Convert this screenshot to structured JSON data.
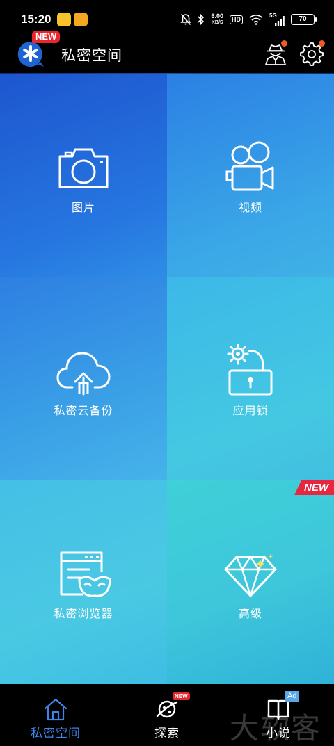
{
  "status_bar": {
    "time": "15:20",
    "net_speed_value": "6.00",
    "net_speed_unit": "KB/S",
    "hd": "HD",
    "signal_tag": "5G",
    "battery": "70"
  },
  "header": {
    "new_badge": "NEW",
    "title": "私密空间"
  },
  "tiles": [
    {
      "label": "图片",
      "icon": "camera-icon"
    },
    {
      "label": "视频",
      "icon": "video-camera-icon"
    },
    {
      "label": "私密云备份",
      "icon": "cloud-upload-icon"
    },
    {
      "label": "应用锁",
      "icon": "app-lock-icon"
    },
    {
      "label": "私密浏览器",
      "icon": "private-browser-icon"
    },
    {
      "label": "高级",
      "icon": "diamond-icon",
      "badge": "NEW"
    }
  ],
  "bottom_nav": [
    {
      "label": "私密空间",
      "icon": "home-icon",
      "active": true
    },
    {
      "label": "探索",
      "icon": "planet-icon",
      "badge": "NEW"
    },
    {
      "label": "小说",
      "icon": "book-icon",
      "badge": "Ad"
    }
  ],
  "watermark": "大软客",
  "colors": {
    "accent": "#3f84e6",
    "badge_red": "#e8262c",
    "notif_orange": "#f15a22"
  }
}
